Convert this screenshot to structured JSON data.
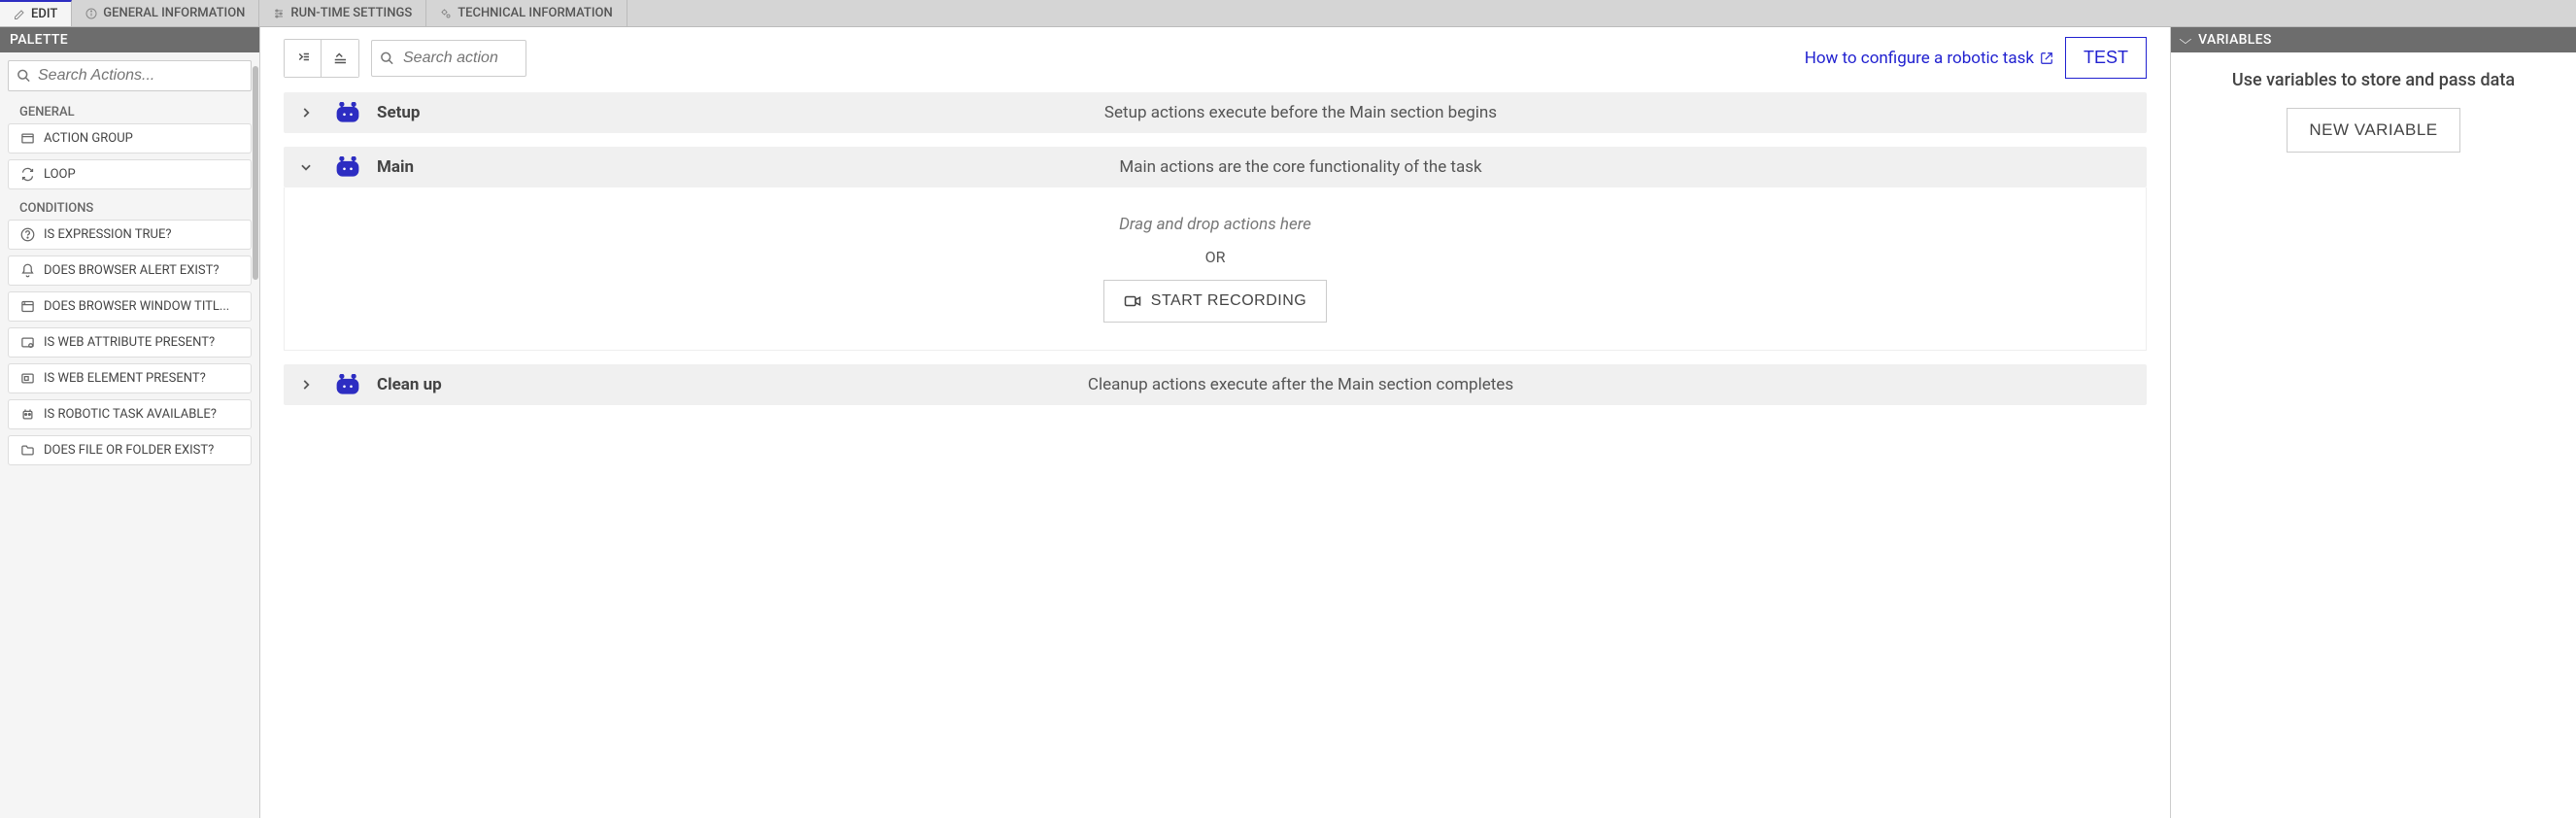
{
  "tabs": [
    {
      "label": "EDIT",
      "icon": "edit-icon",
      "active": true
    },
    {
      "label": "GENERAL INFORMATION",
      "icon": "info-icon",
      "active": false
    },
    {
      "label": "RUN-TIME SETTINGS",
      "icon": "settings-list-icon",
      "active": false
    },
    {
      "label": "TECHNICAL INFORMATION",
      "icon": "gears-icon",
      "active": false
    }
  ],
  "palette": {
    "header": "PALETTE",
    "search_placeholder": "Search Actions...",
    "sections": [
      {
        "title": "GENERAL",
        "items": [
          {
            "label": "ACTION GROUP",
            "icon": "window-icon"
          },
          {
            "label": "LOOP",
            "icon": "loop-icon"
          }
        ]
      },
      {
        "title": "CONDITIONS",
        "items": [
          {
            "label": "IS EXPRESSION TRUE?",
            "icon": "question-circle-icon"
          },
          {
            "label": "DOES BROWSER ALERT EXIST?",
            "icon": "bell-icon"
          },
          {
            "label": "DOES BROWSER WINDOW TITL...",
            "icon": "browser-icon"
          },
          {
            "label": "IS WEB ATTRIBUTE PRESENT?",
            "icon": "attribute-icon"
          },
          {
            "label": "IS WEB ELEMENT PRESENT?",
            "icon": "element-icon"
          },
          {
            "label": "IS ROBOTIC TASK AVAILABLE?",
            "icon": "robot-small-icon"
          },
          {
            "label": "DOES FILE OR FOLDER EXIST?",
            "icon": "folder-icon"
          }
        ]
      }
    ]
  },
  "center": {
    "search_placeholder": "Search action",
    "configure_link": "How to configure a robotic task",
    "test_label": "TEST",
    "sections": {
      "setup": {
        "name": "Setup",
        "desc": "Setup actions execute before the Main section begins",
        "expanded": false
      },
      "main": {
        "name": "Main",
        "desc": "Main actions are the core functionality of the task",
        "expanded": true
      },
      "cleanup": {
        "name": "Clean up",
        "desc": "Cleanup actions execute after the Main section completes",
        "expanded": false
      }
    },
    "main_body": {
      "drop_text": "Drag and drop actions here",
      "or_text": "OR",
      "record_label": "START RECORDING"
    }
  },
  "right": {
    "header": "VARIABLES",
    "hint": "Use variables to store and pass data",
    "new_var_label": "NEW VARIABLE"
  }
}
